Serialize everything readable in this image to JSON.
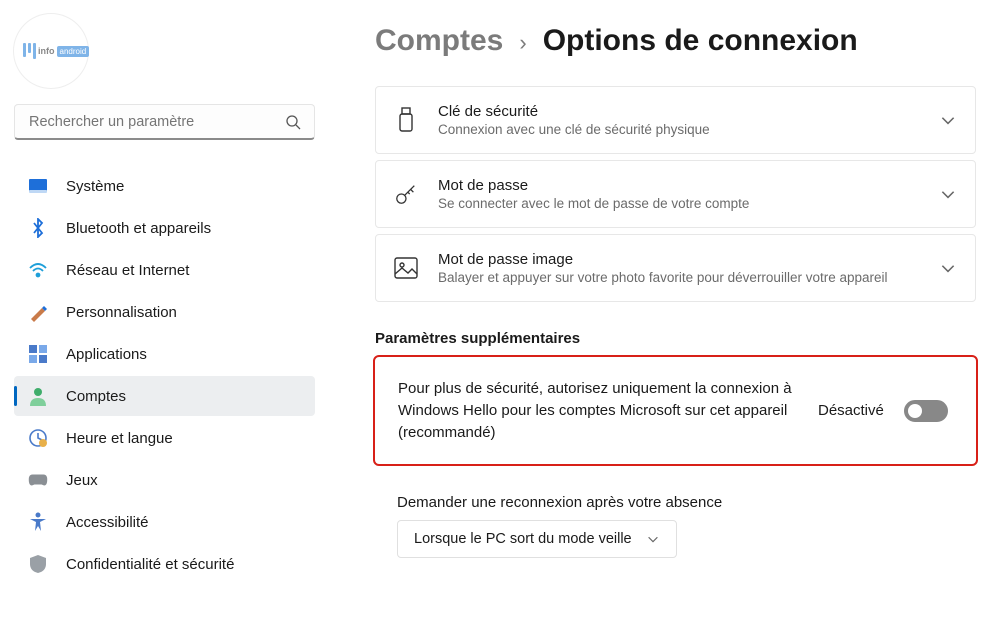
{
  "search": {
    "placeholder": "Rechercher un paramètre"
  },
  "sidebar": {
    "items": [
      {
        "label": "Système",
        "icon": "system"
      },
      {
        "label": "Bluetooth et appareils",
        "icon": "bluetooth"
      },
      {
        "label": "Réseau et Internet",
        "icon": "network"
      },
      {
        "label": "Personnalisation",
        "icon": "personalization"
      },
      {
        "label": "Applications",
        "icon": "apps"
      },
      {
        "label": "Comptes",
        "icon": "accounts"
      },
      {
        "label": "Heure et langue",
        "icon": "time"
      },
      {
        "label": "Jeux",
        "icon": "gaming"
      },
      {
        "label": "Accessibilité",
        "icon": "accessibility"
      },
      {
        "label": "Confidentialité et sécurité",
        "icon": "privacy"
      }
    ],
    "active_index": 5
  },
  "breadcrumb": {
    "parent": "Comptes",
    "sep": "›",
    "current": "Options de connexion"
  },
  "options": [
    {
      "title": "Clé de sécurité",
      "sub": "Connexion avec une clé de sécurité physique"
    },
    {
      "title": "Mot de passe",
      "sub": "Se connecter avec le mot de passe de votre compte"
    },
    {
      "title": "Mot de passe image",
      "sub": "Balayer et appuyer sur votre photo favorite pour déverrouiller votre appareil"
    }
  ],
  "section_head": "Paramètres supplémentaires",
  "hello_only": {
    "text": "Pour plus de sécurité, autorisez uniquement la connexion à Windows Hello pour les comptes Microsoft sur cet appareil (recommandé)",
    "state_label": "Désactivé"
  },
  "reconnect": {
    "label": "Demander une reconnexion après votre absence",
    "select_value": "Lorsque le PC sort du mode veille"
  }
}
